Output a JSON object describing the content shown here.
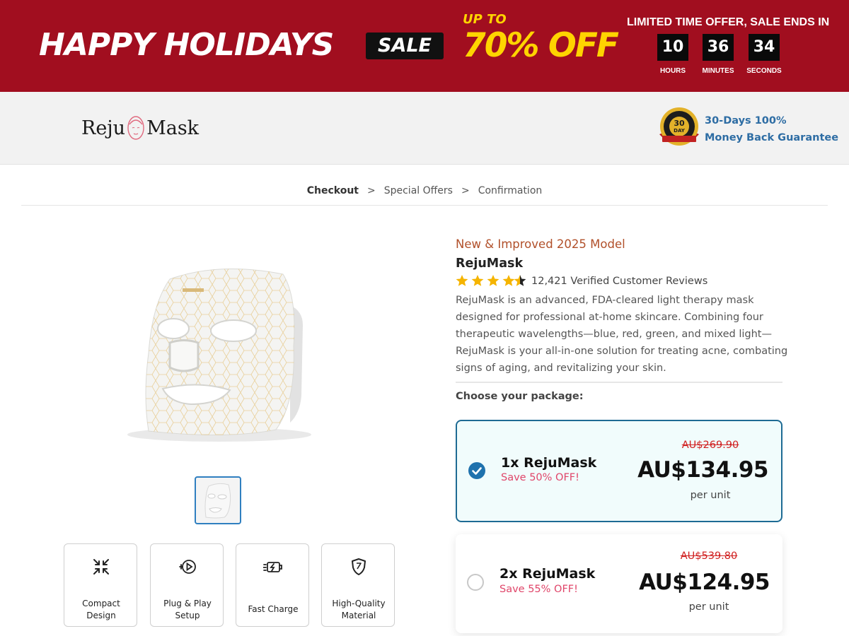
{
  "banner": {
    "title": "HAPPY HOLIDAYS",
    "sale_badge": "SALE",
    "up_to": "UP TO",
    "discount": "70% OFF",
    "countdown_label": "LIMITED TIME OFFER, SALE ENDS IN",
    "countdown": [
      {
        "value": "10",
        "unit": "HOURS"
      },
      {
        "value": "36",
        "unit": "MINUTES"
      },
      {
        "value": "34",
        "unit": "SECONDS"
      }
    ],
    "colors": {
      "background": "#a10e1f",
      "accent": "#ffd400"
    }
  },
  "header": {
    "logo_left": "Reju",
    "logo_right": "Mask",
    "guarantee_line1": "30-Days 100%",
    "guarantee_line2": "Money Back Guarantee",
    "seal_icon": "money-back-seal-icon"
  },
  "breadcrumb": {
    "steps": [
      "Checkout",
      "Special Offers",
      "Confirmation"
    ],
    "separator": ">",
    "current_index": 0
  },
  "gallery": {
    "main_image": "led-light-therapy-mask",
    "thumbnails": [
      "led-light-therapy-mask-thumbnail"
    ],
    "features": [
      {
        "icon": "compress-arrows-icon",
        "line1": "Compact",
        "line2": "Design"
      },
      {
        "icon": "plug-play-icon",
        "line1": "Plug & Play",
        "line2": "Setup"
      },
      {
        "icon": "battery-bolt-icon",
        "line1": "Fast Charge",
        "line2": ""
      },
      {
        "icon": "shield-icon",
        "line1": "High-Quality",
        "line2": "Material"
      }
    ]
  },
  "product": {
    "model_note": "New & Improved 2025 Model",
    "name": "RejuMask",
    "rating": 4.5,
    "reviews": "12,421 Verified Customer Reviews",
    "description": "RejuMask is an advanced, FDA-cleared light therapy mask designed for professional at-home skincare. Combining four therapeutic wavelengths—blue, red, green, and mixed light—RejuMask is your all-in-one solution for treating acne, combating signs of aging, and revitalizing your skin.",
    "choose_label": "Choose your package:"
  },
  "packages": [
    {
      "qty": "1x RejuMask",
      "save": "Save 50% OFF!",
      "old_price": "AU$269.90",
      "price": "AU$134.95",
      "per": "per unit",
      "selected": true
    },
    {
      "qty": "2x RejuMask",
      "save": "Save 55% OFF!",
      "old_price": "AU$539.80",
      "price": "AU$124.95",
      "per": "per unit",
      "selected": false
    }
  ]
}
